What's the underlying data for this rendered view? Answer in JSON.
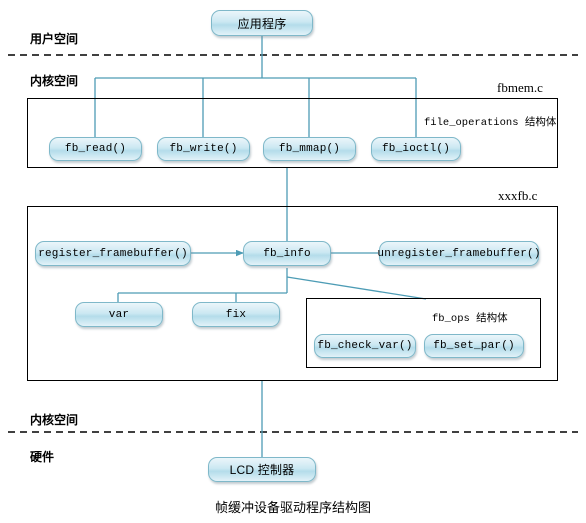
{
  "diagram": {
    "caption": "帧缓冲设备驱动程序结构图",
    "layer_labels": {
      "user_space": "用户空间",
      "kernel_space_top": "内核空间",
      "kernel_space_bottom": "内核空间",
      "hardware": "硬件"
    },
    "file_labels": {
      "fbmem": "fbmem.c",
      "xxxfb": "xxxfb.c"
    },
    "struct_labels": {
      "file_operations": "file_operations 结构体",
      "fb_ops": "fb_ops 结构体"
    },
    "nodes": {
      "app": "应用程序",
      "fb_read": "fb_read()",
      "fb_write": "fb_write()",
      "fb_mmap": "fb_mmap()",
      "fb_ioctl": "fb_ioctl()",
      "register_framebuffer": "register_framebuffer()",
      "fb_info": "fb_info",
      "unregister_framebuffer": "unregister_framebuffer()",
      "var": "var",
      "fix": "fix",
      "fb_check_var": "fb_check_var()",
      "fb_set_par": "fb_set_par()",
      "lcd_controller": "LCD 控制器"
    },
    "colors": {
      "connector": "#4d9cb5",
      "node_border": "#7fb8c9",
      "frame_border": "#000000",
      "background": "#ffffff"
    }
  }
}
